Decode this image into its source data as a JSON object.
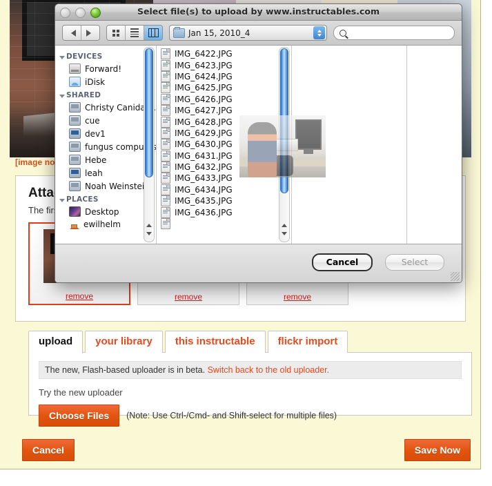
{
  "page": {
    "image_missing_label": "[image not found]",
    "attached": {
      "title": "Attached Images",
      "subtitle": "The first image will be the main image for this step.",
      "thumbs": [
        {
          "remove_label": "remove",
          "primary": true
        },
        {
          "remove_label": "remove",
          "primary": false
        },
        {
          "remove_label": "remove",
          "primary": false
        }
      ]
    },
    "uploader": {
      "tabs": [
        {
          "label": "upload",
          "active": true
        },
        {
          "label": "your library",
          "active": false
        },
        {
          "label": "this instructable",
          "active": false
        },
        {
          "label": "flickr import",
          "active": false
        }
      ],
      "beta_notice": "The new, Flash-based uploader is in beta.",
      "beta_link": "Switch back to the old uploader.",
      "try_label": "Try the new uploader",
      "choose_files_label": "Choose Files",
      "choose_files_note": "(Note: Use Ctrl-/Cmd- and Shift-select for multiple files)"
    },
    "footer": {
      "cancel_label": "Cancel",
      "save_label": "Save Now"
    },
    "colors": {
      "background": "#fbf8d6",
      "accent_orange": "#e8491d",
      "link_red": "#d41a1a"
    }
  },
  "dialog": {
    "title": "Select file(s) to upload by www.instructables.com",
    "traffic_lights": [
      "close-disabled",
      "minimize-disabled",
      "zoom-green"
    ],
    "toolbar": {
      "back_icon": "triangle-left-icon",
      "forward_icon": "triangle-right-icon",
      "view_modes": [
        {
          "name": "icon-view",
          "selected": false
        },
        {
          "name": "list-view",
          "selected": false
        },
        {
          "name": "column-view",
          "selected": true
        }
      ],
      "path_label": "Jan 15, 2010_4",
      "search_placeholder": "",
      "search_value": ""
    },
    "sidebar": {
      "groups": [
        {
          "label": "DEVICES",
          "items": [
            {
              "label": "Forward!",
              "icon": "hard-drive-icon"
            },
            {
              "label": "iDisk",
              "icon": "idisk-icon"
            }
          ]
        },
        {
          "label": "SHARED",
          "items": [
            {
              "label": "Christy Canida'…",
              "icon": "computer-icon"
            },
            {
              "label": "cue",
              "icon": "computer-icon"
            },
            {
              "label": "dev1",
              "icon": "imac-icon"
            },
            {
              "label": "fungus computus",
              "icon": "computer-icon"
            },
            {
              "label": "Hebe",
              "icon": "computer-icon"
            },
            {
              "label": "leah",
              "icon": "imac-icon"
            },
            {
              "label": "Noah Weinstein",
              "icon": "computer-icon"
            }
          ]
        },
        {
          "label": "PLACES",
          "items": [
            {
              "label": "Desktop",
              "icon": "desktop-icon"
            },
            {
              "label": "ewilhelm",
              "icon": "home-icon"
            }
          ]
        }
      ]
    },
    "files": [
      "IMG_6422.JPG",
      "IMG_6423.JPG",
      "IMG_6424.JPG",
      "IMG_6425.JPG",
      "IMG_6426.JPG",
      "IMG_6427.JPG",
      "IMG_6428.JPG",
      "IMG_6429.JPG",
      "IMG_6430.JPG",
      "IMG_6431.JPG",
      "IMG_6432.JPG",
      "IMG_6433.JPG",
      "IMG_6434.JPG",
      "IMG_6435.JPG",
      "IMG_6436.JPG"
    ],
    "buttons": {
      "cancel_label": "Cancel",
      "select_label": "Select",
      "select_disabled": true,
      "cancel_is_default": true
    }
  }
}
